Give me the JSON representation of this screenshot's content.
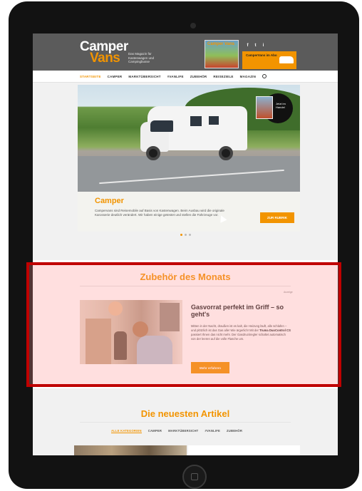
{
  "site": {
    "logo_line1": "Camper",
    "logo_line2": "Vans",
    "logo_tagline": "Das Magazin für Kastenwagen und Campingbusse",
    "magazine_thumb_text": "Camper Vans",
    "social": [
      "f",
      "t",
      "i"
    ],
    "promo_text": "CamperVans im Abo"
  },
  "nav": {
    "items": [
      "STARTSEITE",
      "CAMPER",
      "MARKTÜBERSICHT",
      "#VANLIFE",
      "ZUBEHÖR",
      "REISEZIELE",
      "MAGAZIN"
    ],
    "active_index": 0
  },
  "hero": {
    "title": "Camper",
    "text": "Campervans sind Reisemobile auf Basis von Kastenwagen. Beim Ausbau wird die originale Karosserie deutlich verändert. Wir haben einige getestet und stellen die Fahrzeuge vor.",
    "button": "ZUR RUBRIK",
    "magazine_badge_text": "Jetzt im Handel"
  },
  "carousel": {
    "slides": 3,
    "active_index": 0
  },
  "accessory": {
    "section_title": "Zubehör des Monats",
    "ad_label": "Anzeige",
    "heading": "Gasvorrat perfekt im Griff – so geht's",
    "text_before": "Mitten in der Nacht, draußen ist es kalt, die Heizung läuft, alle schlafen – und plötzlich ist das Gas alle! Wie ärgerlich! Mit der ",
    "text_bold": "Truma DuoControl CS",
    "text_after": " passiert Ihnen das nicht mehr. Der Gasdruckregler schaltet automatisch von der leeren auf die volle Flasche um.",
    "button": "Mehr erfahren"
  },
  "latest": {
    "section_title": "Die neuesten Artikel",
    "filters": [
      "ALLE KATEGORIEN",
      "CAMPER",
      "MARKTÜBERSICHT",
      "#VANLIFE",
      "ZUBEHÖR"
    ],
    "active_filter_index": 0
  },
  "colors": {
    "accent": "#f29400",
    "header_bg": "#5b5b5b",
    "highlight_border": "#c00000"
  }
}
